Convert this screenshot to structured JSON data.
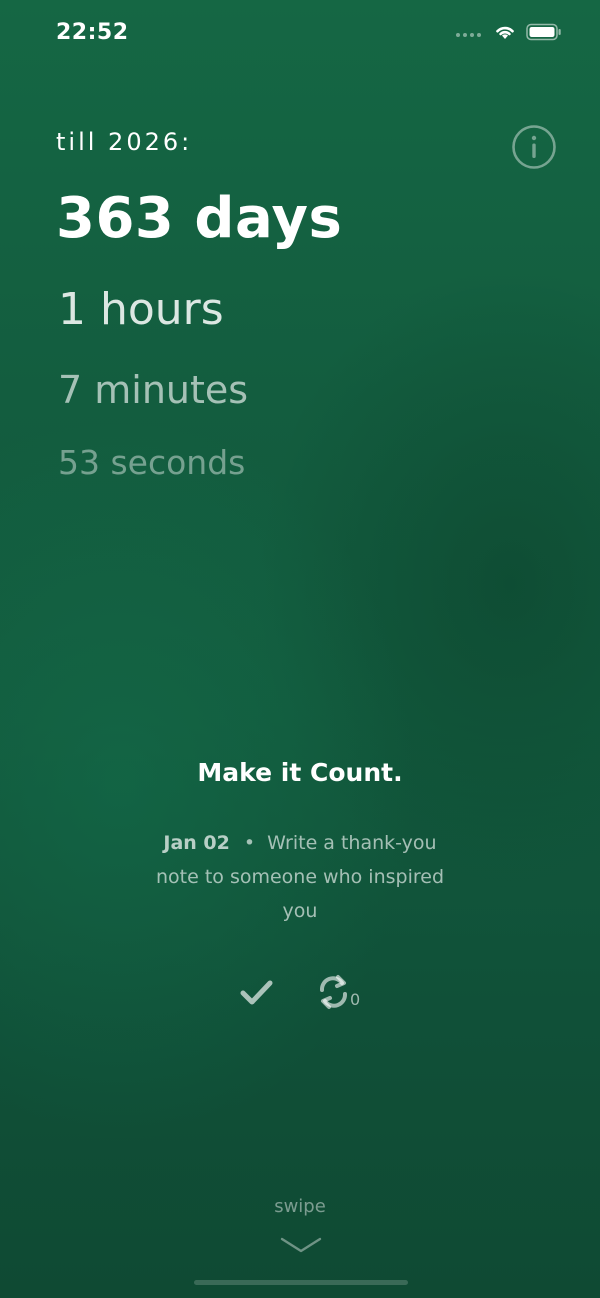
{
  "status_bar": {
    "time": "22:52"
  },
  "countdown": {
    "label": "till 2026:",
    "days": "363 days",
    "hours": "1 hours",
    "minutes": "7 minutes",
    "seconds": "53 seconds"
  },
  "prompt": {
    "headline": "Make it Count.",
    "date": "Jan 02",
    "bullet": "•",
    "text": "Write a thank-you note to someone who inspired you",
    "refresh_count": "0"
  },
  "footer": {
    "swipe_label": "swipe"
  },
  "icons": {
    "info": "info-icon",
    "check": "checkmark-icon",
    "refresh": "refresh-icon",
    "chevron": "chevron-down-icon",
    "wifi": "wifi-icon",
    "battery": "battery-icon",
    "signal": "signal-dots-icon"
  },
  "colors": {
    "background_top": "#156744",
    "background_bottom": "#0f4a33",
    "text": "#ffffff"
  }
}
